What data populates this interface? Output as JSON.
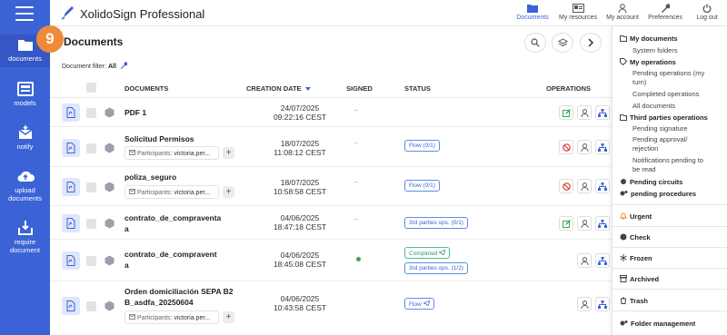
{
  "step_badge": "9",
  "sidebar": {
    "items": [
      {
        "label": "documents"
      },
      {
        "label": "models"
      },
      {
        "label": "notify"
      },
      {
        "label_1": "upload",
        "label_2": "documents"
      },
      {
        "label_1": "require",
        "label_2": "document"
      }
    ]
  },
  "header": {
    "app_title": "XolidoSign Professional",
    "nav": [
      "Documents",
      "My resources",
      "My account",
      "Preferences",
      "Log out"
    ]
  },
  "page": {
    "title": "Documents",
    "filter_label": "Document filter:",
    "filter_value": "All"
  },
  "table": {
    "columns": [
      "DOCUMENTS",
      "CREATION DATE",
      "SIGNED",
      "STATUS",
      "OPERATIONS"
    ],
    "participants_label": "Participants:",
    "rows": [
      {
        "name": "PDF 1",
        "date": "24/07/2025",
        "time": "09:22:16 CEST",
        "signed": "–"
      },
      {
        "name": "Solicitud Permisos",
        "participant": "victoria.per...",
        "date": "18/07/2025",
        "time": "11:08:12 CEST",
        "signed": "–",
        "status": "Flow (0/1)"
      },
      {
        "name": "poliza_seguro",
        "participant": "victoria.per...",
        "date": "18/07/2025",
        "time": "10:58:58 CEST",
        "signed": "–",
        "status": "Flow (0/1)"
      },
      {
        "name_1": "contrato_de_compraventa",
        "name_2": "a",
        "date": "04/06/2025",
        "time": "18:47:18 CEST",
        "signed": "–",
        "status": "3rd parties ops. (0/1)"
      },
      {
        "name_1": "contrato_de_compravent",
        "name_2": "a",
        "date": "04/06/2025",
        "time": "18:45:08 CEST",
        "status_1": "Completed",
        "status_2": "3rd parties ops. (1/2)"
      },
      {
        "name_1": "Orden domiciliación SEPA B2",
        "name_2": "B_asdfa_20250604",
        "participant": "victoria.per...",
        "date": "04/06/2025",
        "time": "10:43:58 CEST",
        "status": "Flow"
      }
    ]
  },
  "panel": {
    "my_documents": "My documents",
    "system_folders": "System folders",
    "my_operations": "My operations",
    "pending_ops_1": "Pending operations (my",
    "pending_ops_2": "turn)",
    "completed_ops": "Completed operations",
    "all_documents": "All documents",
    "third_party_ops": "Third parties operations",
    "pending_signature": "Pending signature",
    "pending_approval_1": "Pending approval/",
    "pending_approval_2": "rejection",
    "notif_pending_1": "Notifications pending to",
    "notif_pending_2": "be read",
    "pending_circuits": "Pending circuits",
    "pending_procedures": "pending procedures",
    "urgent": "Urgent",
    "check": "Check",
    "frozen": "Frozen",
    "archived": "Archived",
    "trash": "Trash",
    "folder_management": "Folder management"
  },
  "colors": {
    "brand": "#3b63d6",
    "urgent": "#f08c1a",
    "badge": "#ee8a3a"
  }
}
